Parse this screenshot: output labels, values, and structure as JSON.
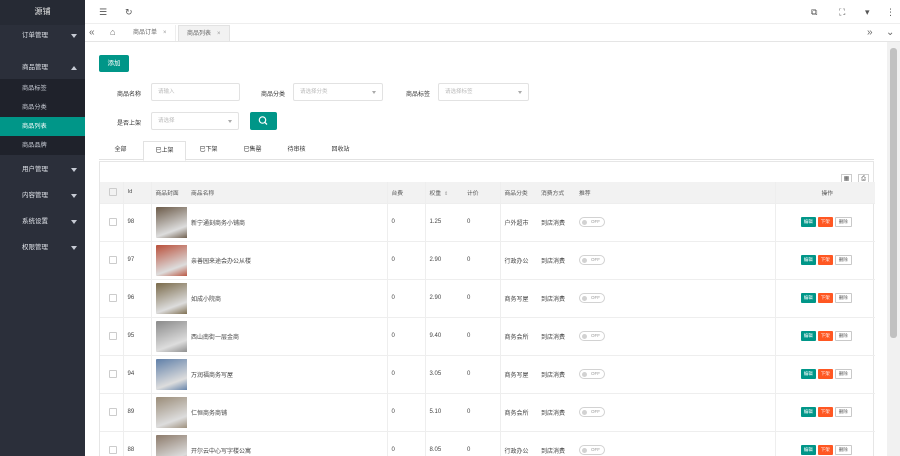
{
  "sidebar": {
    "brand": "源铺",
    "groups": [
      {
        "label": "订单管理",
        "open": false
      },
      {
        "label": "商品管理",
        "open": true,
        "items": [
          "商品标签",
          "商品分类",
          "商品列表",
          "商品品牌"
        ],
        "active_item": "商品列表"
      },
      {
        "label": "用户管理",
        "open": false
      },
      {
        "label": "内容管理",
        "open": false
      },
      {
        "label": "系统设置",
        "open": false
      },
      {
        "label": "权限管理",
        "open": false
      }
    ]
  },
  "topbar": {
    "menu_icon": "☰",
    "refresh_icon": "↻",
    "icons": [
      "⧉",
      "⛶",
      "▾",
      "⋮"
    ]
  },
  "tabs": {
    "back": "«",
    "home": "⌂",
    "items": [
      {
        "label": "商品订单",
        "close": "×"
      },
      {
        "label": "商品列表",
        "close": "×",
        "active": true
      }
    ],
    "forward": "»",
    "dropdown": "⌄"
  },
  "toolbar": {
    "add_label": "添加"
  },
  "filters": {
    "name_label": "商品名称",
    "name_placeholder": "请输入",
    "category_label": "商品分类",
    "category_placeholder": "请选择分类",
    "tag_label": "商品标签",
    "tag_placeholder": "请选择标签",
    "onsale_label": "是否上架",
    "onsale_placeholder": "请选择"
  },
  "content_tabs": [
    "全部",
    "已上架",
    "已下架",
    "已售罄",
    "待审核",
    "回收站"
  ],
  "table": {
    "headers": [
      "Id",
      "商品封面",
      "商品名称",
      "台费",
      "权重",
      "计价",
      "商品分类",
      "消费方式",
      "推荐",
      "操作"
    ],
    "sort_icon": "⇕",
    "actions": {
      "edit": "编辑",
      "down": "下架",
      "delete": "删除"
    },
    "rows": [
      {
        "id": "98",
        "name": "新宁通刻商务小铺商",
        "fee": "0",
        "weight": "1.25",
        "price": "0",
        "category": "户外超市",
        "mode": "到店消费",
        "rec": "OFF",
        "thumb_color": "#6b5a48"
      },
      {
        "id": "97",
        "name": "亲善园来途会办公从楼",
        "fee": "0",
        "weight": "2.90",
        "price": "0",
        "category": "行政办公",
        "mode": "到店消费",
        "rec": "OFF",
        "thumb_color": "#b94f3a"
      },
      {
        "id": "96",
        "name": "如成小院商",
        "fee": "0",
        "weight": "2.90",
        "price": "0",
        "category": "商务写屋",
        "mode": "到店消费",
        "rec": "OFF",
        "thumb_color": "#7a6a4a"
      },
      {
        "id": "95",
        "name": "西山南街一层金商",
        "fee": "0",
        "weight": "9.40",
        "price": "0",
        "category": "商务会所",
        "mode": "到店消费",
        "rec": "OFF",
        "thumb_color": "#8a8a8a"
      },
      {
        "id": "94",
        "name": "万润福商务写屋",
        "fee": "0",
        "weight": "3.05",
        "price": "0",
        "category": "商务写屋",
        "mode": "到店消费",
        "rec": "OFF",
        "thumb_color": "#5f7fa8"
      },
      {
        "id": "89",
        "name": "仁恒商务商铺",
        "fee": "0",
        "weight": "5.10",
        "price": "0",
        "category": "商务会所",
        "mode": "到店消费",
        "rec": "OFF",
        "thumb_color": "#9a8c78"
      },
      {
        "id": "88",
        "name": "开尔云中心写字楼公寓",
        "fee": "0",
        "weight": "8.05",
        "price": "0",
        "category": "行政办公",
        "mode": "到店消费",
        "rec": "OFF",
        "thumb_color": "#8c7a6a"
      }
    ]
  }
}
